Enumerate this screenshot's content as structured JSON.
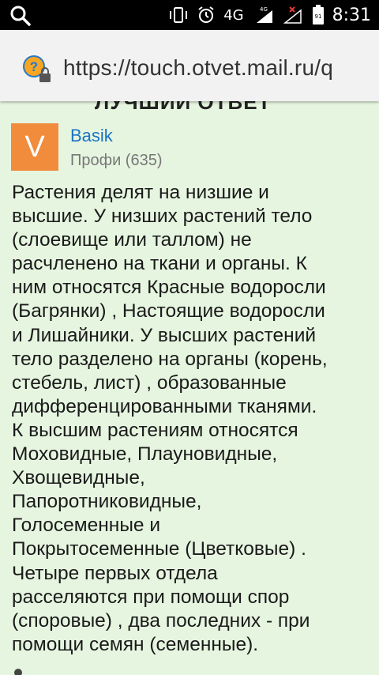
{
  "status_bar": {
    "network": "4G",
    "network_sup": "4G",
    "battery": "91",
    "time": "8:31"
  },
  "browser": {
    "url": "https://touch.otvet.mail.ru/q"
  },
  "content": {
    "cut_heading": "ЛУЧШИЙ ОТВЕТ",
    "author": {
      "avatar_letter": "V",
      "name": "Basik",
      "rank": "Профи (635)"
    },
    "answer_lines": [
      "Растения делят на низшие и",
      "высшие. У низших растений тело",
      "(слоевище или таллом) не",
      "расчленено на ткани и органы. К",
      "ним относятся Красные водоросли",
      "(Багрянки) , Настоящие водоросли",
      "и Лишайники. У высших растений",
      "тело разделено на органы (корень,",
      "стебель, лист) , образованные",
      "дифференцированными тканями.",
      "К высшим растениям относятся",
      "Моховидные, Плауновидные,",
      "Хвощевидные,",
      "Папоротниковидные,",
      "Голосеменные и",
      "Покрытосеменные (Цветковые) .",
      "Четыре первых отдела",
      "расселяются при помощи спор",
      "(споровые) , два последних - при",
      "помощи семян (семенные)."
    ]
  },
  "colors": {
    "status_bg": "#000000",
    "url_bg": "#f2f2f2",
    "content_bg": "#e6f5e0",
    "avatar_bg": "#f08c3c",
    "author_link": "#1a73c4"
  }
}
